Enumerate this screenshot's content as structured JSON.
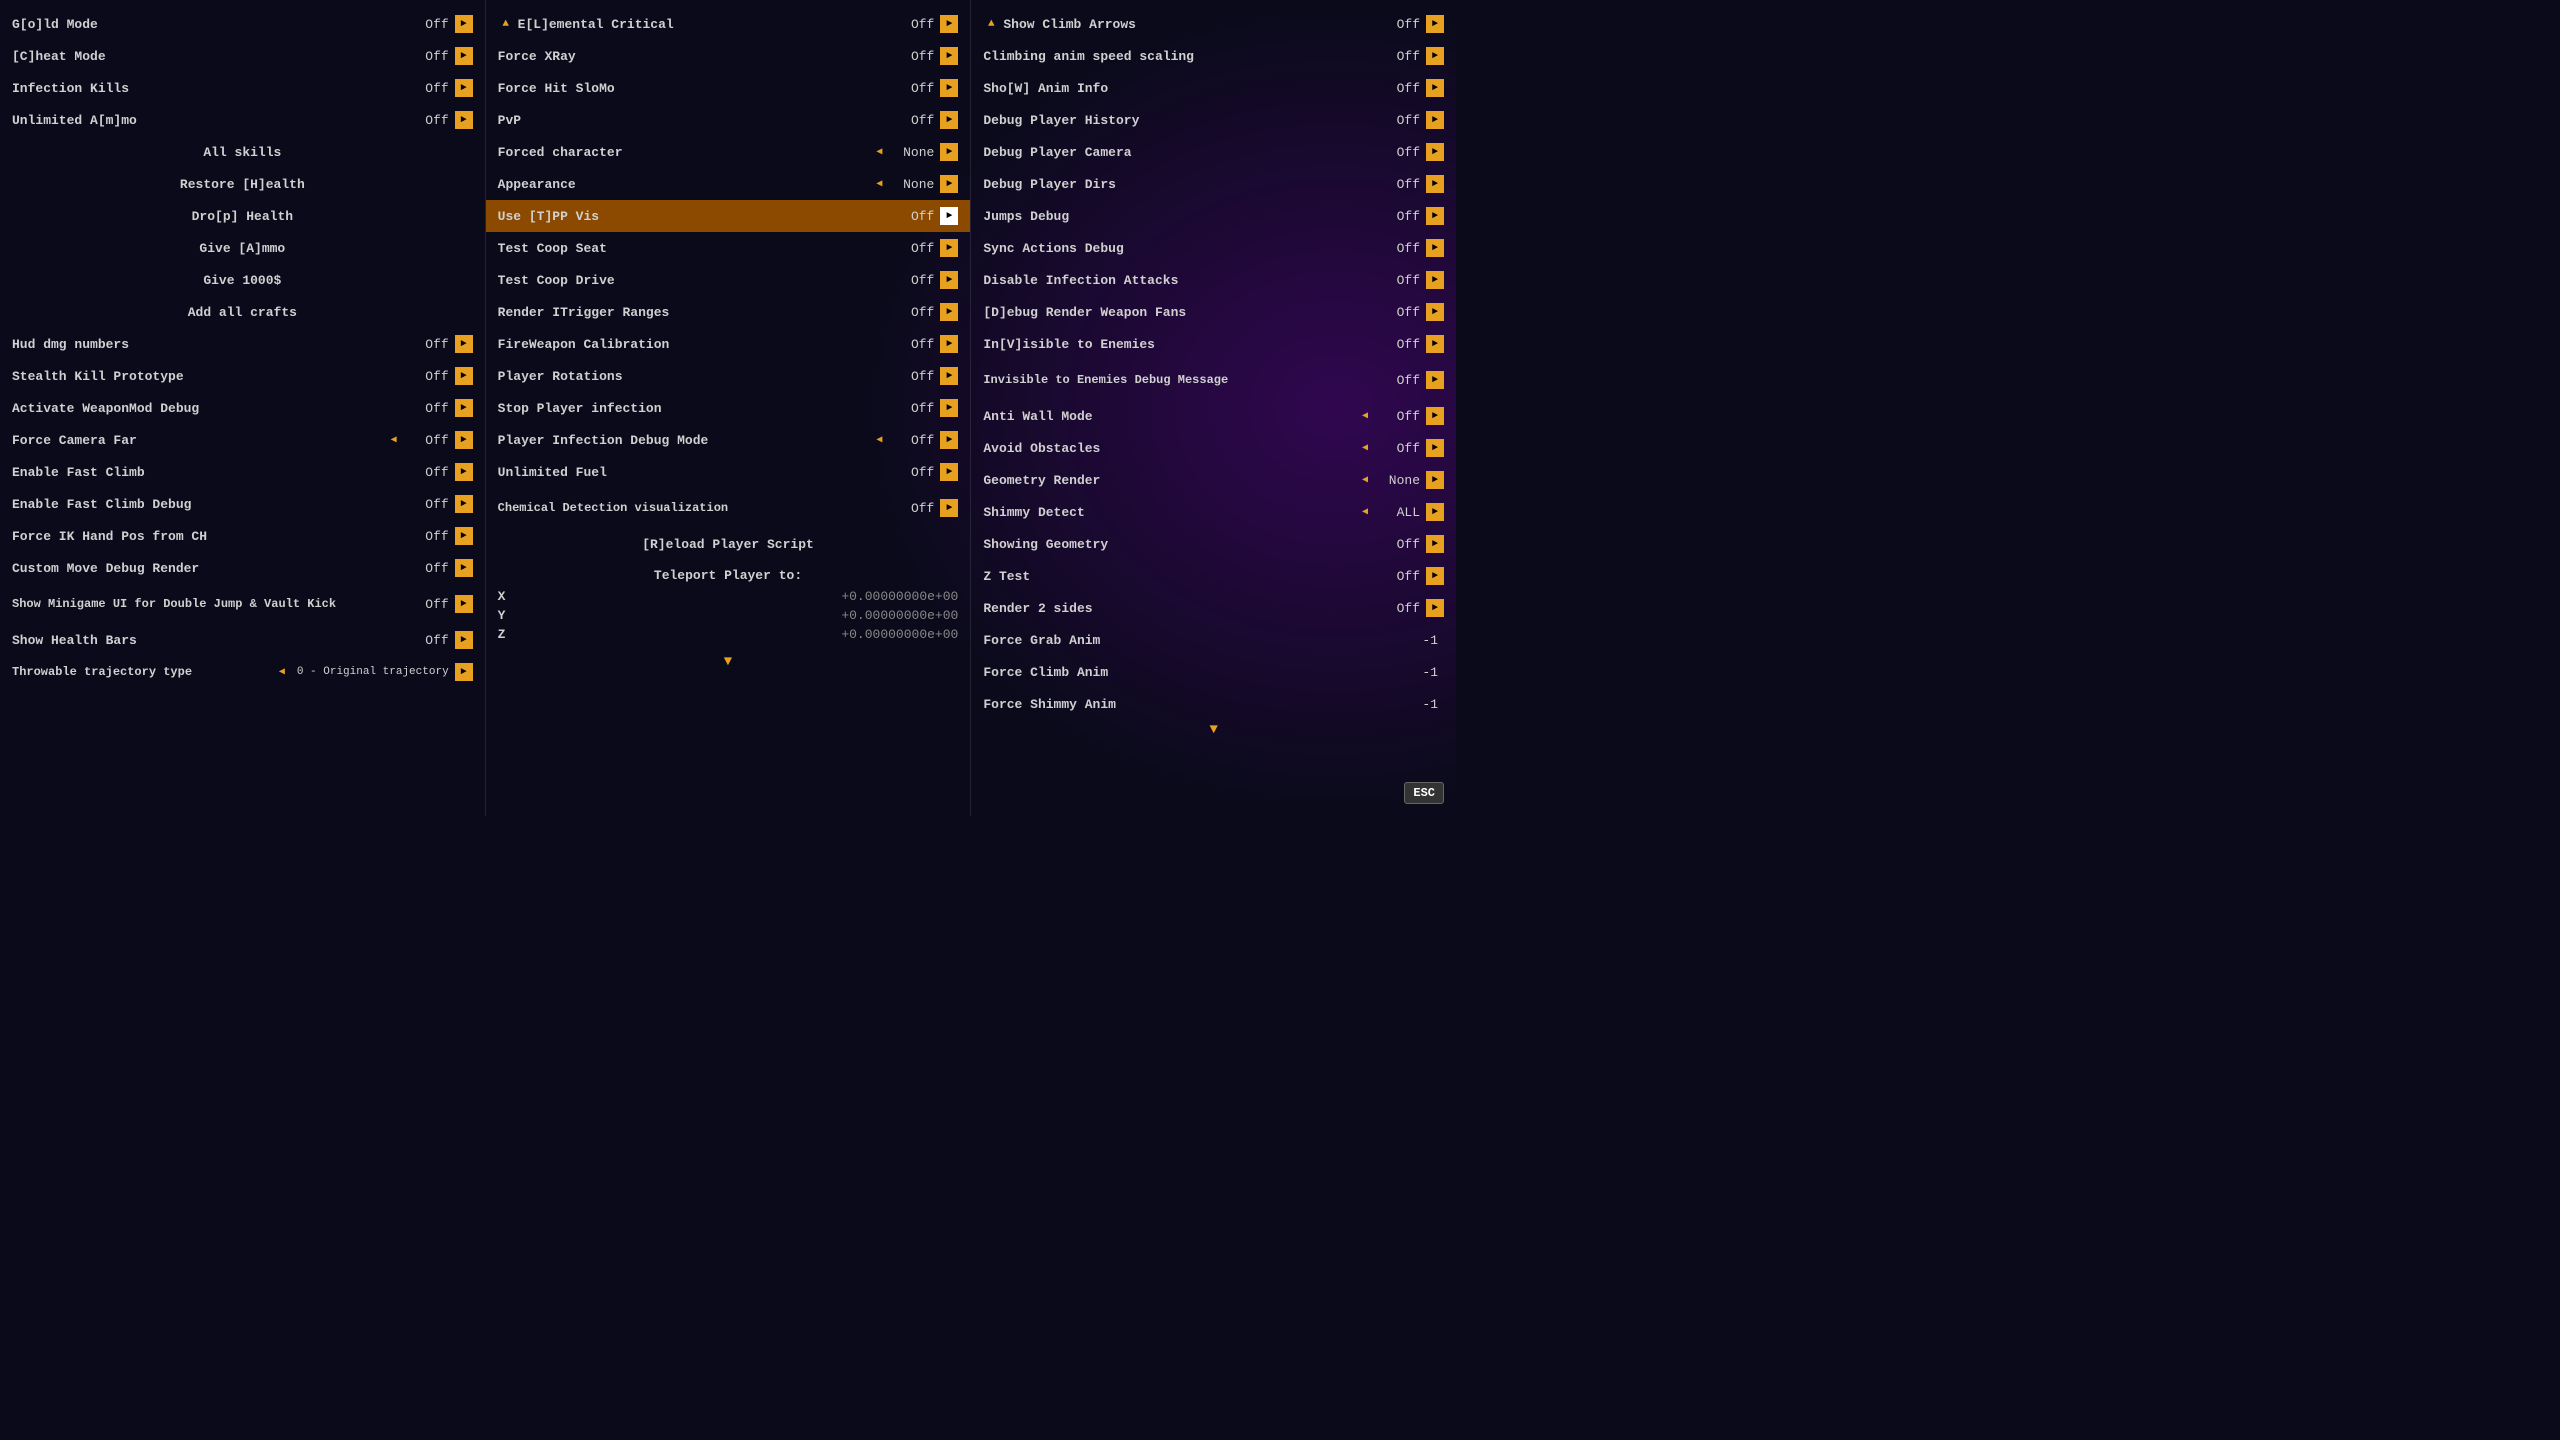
{
  "columns": [
    {
      "id": "col1",
      "items": [
        {
          "id": "gold-mode",
          "label": "G[o]ld Mode",
          "value": "Off",
          "hasLeft": false,
          "hasRight": true,
          "type": "toggle"
        },
        {
          "id": "cheat-mode",
          "label": "[C]heat Mode",
          "value": "Off",
          "hasLeft": false,
          "hasRight": true,
          "type": "toggle"
        },
        {
          "id": "infection-kills",
          "label": "Infection Kills",
          "value": "Off",
          "hasLeft": false,
          "hasRight": true,
          "type": "toggle"
        },
        {
          "id": "unlimited-ammo",
          "label": "Unlimited A[m]mo",
          "value": "Off",
          "hasLeft": false,
          "hasRight": true,
          "type": "toggle"
        },
        {
          "id": "all-skills",
          "label": "All skills",
          "value": "",
          "hasLeft": false,
          "hasRight": false,
          "type": "center"
        },
        {
          "id": "restore-health",
          "label": "Restore [H]ealth",
          "value": "",
          "hasLeft": false,
          "hasRight": false,
          "type": "center"
        },
        {
          "id": "drop-health",
          "label": "Dro[p] Health",
          "value": "",
          "hasLeft": false,
          "hasRight": false,
          "type": "center"
        },
        {
          "id": "give-ammo",
          "label": "Give [A]mmo",
          "value": "",
          "hasLeft": false,
          "hasRight": false,
          "type": "center"
        },
        {
          "id": "give-1000",
          "label": "Give 1000$",
          "value": "",
          "hasLeft": false,
          "hasRight": false,
          "type": "center"
        },
        {
          "id": "add-crafts",
          "label": "Add all crafts",
          "value": "",
          "hasLeft": false,
          "hasRight": false,
          "type": "center"
        },
        {
          "id": "hud-dmg",
          "label": "Hud dmg numbers",
          "value": "Off",
          "hasLeft": false,
          "hasRight": true,
          "type": "toggle"
        },
        {
          "id": "stealth-kill",
          "label": "Stealth Kill Prototype",
          "value": "Off",
          "hasLeft": false,
          "hasRight": true,
          "type": "toggle"
        },
        {
          "id": "weaponmod-debug",
          "label": "Activate WeaponMod Debug",
          "value": "Off",
          "hasLeft": false,
          "hasRight": true,
          "type": "toggle"
        },
        {
          "id": "force-camera-far",
          "label": "Force Camera Far",
          "value": "Off",
          "hasLeft": true,
          "hasRight": true,
          "type": "toggle"
        },
        {
          "id": "enable-fast-climb",
          "label": "Enable Fast Climb",
          "value": "Off",
          "hasLeft": false,
          "hasRight": true,
          "type": "toggle"
        },
        {
          "id": "fast-climb-debug",
          "label": "Enable Fast Climb Debug",
          "value": "Off",
          "hasLeft": false,
          "hasRight": true,
          "type": "toggle"
        },
        {
          "id": "force-ik-hand",
          "label": "Force IK Hand Pos from CH",
          "value": "Off",
          "hasLeft": false,
          "hasRight": true,
          "type": "toggle"
        },
        {
          "id": "custom-move-debug",
          "label": "Custom Move Debug Render",
          "value": "Off",
          "hasLeft": false,
          "hasRight": true,
          "type": "toggle"
        },
        {
          "id": "show-minigame",
          "label": "Show Minigame UI for Double Jump & Vault Kick",
          "value": "Off",
          "hasLeft": false,
          "hasRight": true,
          "type": "toggle"
        },
        {
          "id": "show-health-bars",
          "label": "Show Health Bars",
          "value": "Off",
          "hasLeft": false,
          "hasRight": true,
          "type": "toggle"
        },
        {
          "id": "throwable-traj",
          "label": "Throwable trajectory type",
          "value": "0 - Original trajectory",
          "hasLeft": true,
          "hasRight": true,
          "type": "toggle"
        }
      ]
    },
    {
      "id": "col2",
      "sectionArrow": "up",
      "sectionLabel": "E[L]emental Critical",
      "sectionValue": "Off",
      "items": [
        {
          "id": "force-xray",
          "label": "Force XRay",
          "value": "Off",
          "hasLeft": false,
          "hasRight": true,
          "type": "toggle"
        },
        {
          "id": "force-hit-slomo",
          "label": "Force Hit SloMo",
          "value": "Off",
          "hasLeft": false,
          "hasRight": true,
          "type": "toggle"
        },
        {
          "id": "pvp",
          "label": "PvP",
          "value": "Off",
          "hasLeft": false,
          "hasRight": true,
          "type": "toggle"
        },
        {
          "id": "forced-character",
          "label": "Forced character",
          "value": "None",
          "hasLeft": true,
          "hasRight": true,
          "type": "select"
        },
        {
          "id": "appearance",
          "label": "Appearance",
          "value": "None",
          "hasLeft": true,
          "hasRight": true,
          "type": "select"
        },
        {
          "id": "use-tpp-vis",
          "label": "Use [T]PP Vis",
          "value": "Off",
          "hasLeft": false,
          "hasRight": true,
          "type": "toggle",
          "highlighted": true
        },
        {
          "id": "test-coop-seat",
          "label": "Test Coop Seat",
          "value": "Off",
          "hasLeft": false,
          "hasRight": true,
          "type": "toggle"
        },
        {
          "id": "test-coop-drive",
          "label": "Test Coop Drive",
          "value": "Off",
          "hasLeft": false,
          "hasRight": true,
          "type": "toggle"
        },
        {
          "id": "render-itrigger",
          "label": "Render ITrigger Ranges",
          "value": "Off",
          "hasLeft": false,
          "hasRight": true,
          "type": "toggle"
        },
        {
          "id": "fireweapon-cal",
          "label": "FireWeapon Calibration",
          "value": "Off",
          "hasLeft": false,
          "hasRight": true,
          "type": "toggle"
        },
        {
          "id": "player-rotations",
          "label": "Player Rotations",
          "value": "Off",
          "hasLeft": false,
          "hasRight": true,
          "type": "toggle"
        },
        {
          "id": "stop-infection",
          "label": "Stop Player infection",
          "value": "Off",
          "hasLeft": false,
          "hasRight": true,
          "type": "toggle"
        },
        {
          "id": "infection-debug",
          "label": "Player Infection Debug Mode",
          "value": "Off",
          "hasLeft": true,
          "hasRight": true,
          "type": "select"
        },
        {
          "id": "unlimited-fuel",
          "label": "Unlimited Fuel",
          "value": "Off",
          "hasLeft": false,
          "hasRight": true,
          "type": "toggle"
        },
        {
          "id": "chemical-detection",
          "label": "Chemical Detection visualization",
          "value": "Off",
          "hasLeft": false,
          "hasRight": true,
          "type": "toggle"
        },
        {
          "id": "reload-script",
          "label": "[R]eload Player Script",
          "value": "",
          "hasLeft": false,
          "hasRight": false,
          "type": "center"
        }
      ],
      "teleport": {
        "title": "Teleport Player to:",
        "axes": [
          {
            "axis": "X",
            "value": "+0.00000000e+00"
          },
          {
            "axis": "Y",
            "value": "+0.00000000e+00"
          },
          {
            "axis": "Z",
            "value": "+0.00000000e+00"
          }
        ]
      }
    },
    {
      "id": "col3",
      "sectionArrow": "up",
      "sectionLabel": "Show Climb Arrows",
      "sectionValue": "Off",
      "items": [
        {
          "id": "climb-anim-speed",
          "label": "Climbing anim speed scaling",
          "value": "Off",
          "hasLeft": false,
          "hasRight": true,
          "type": "toggle"
        },
        {
          "id": "show-anim-info",
          "label": "Sho[W] Anim Info",
          "value": "Off",
          "hasLeft": false,
          "hasRight": true,
          "type": "toggle"
        },
        {
          "id": "debug-player-history",
          "label": "Debug Player History",
          "value": "Off",
          "hasLeft": false,
          "hasRight": true,
          "type": "toggle"
        },
        {
          "id": "debug-player-camera",
          "label": "Debug Player Camera",
          "value": "Off",
          "hasLeft": false,
          "hasRight": true,
          "type": "toggle"
        },
        {
          "id": "debug-player-dirs",
          "label": "Debug Player Dirs",
          "value": "Off",
          "hasLeft": false,
          "hasRight": true,
          "type": "toggle"
        },
        {
          "id": "jumps-debug",
          "label": "Jumps Debug",
          "value": "Off",
          "hasLeft": false,
          "hasRight": true,
          "type": "toggle"
        },
        {
          "id": "sync-actions-debug",
          "label": "Sync Actions Debug",
          "value": "Off",
          "hasLeft": false,
          "hasRight": true,
          "type": "toggle"
        },
        {
          "id": "disable-infection",
          "label": "Disable Infection Attacks",
          "value": "Off",
          "hasLeft": false,
          "hasRight": true,
          "type": "toggle"
        },
        {
          "id": "debug-render-weapon",
          "label": "[D]ebug Render Weapon Fans",
          "value": "Off",
          "hasLeft": false,
          "hasRight": true,
          "type": "toggle"
        },
        {
          "id": "invisible-enemies",
          "label": "In[V]isible to Enemies",
          "value": "Off",
          "hasLeft": false,
          "hasRight": true,
          "type": "toggle"
        },
        {
          "id": "invisible-debug-msg",
          "label": "Invisible to Enemies Debug Message",
          "value": "Off",
          "hasLeft": false,
          "hasRight": true,
          "type": "toggle"
        },
        {
          "id": "anti-wall-mode",
          "label": "Anti Wall Mode",
          "value": "Off",
          "hasLeft": true,
          "hasRight": true,
          "type": "select"
        },
        {
          "id": "avoid-obstacles",
          "label": "Avoid Obstacles",
          "value": "Off",
          "hasLeft": true,
          "hasRight": true,
          "type": "select"
        },
        {
          "id": "geometry-render",
          "label": "Geometry Render",
          "value": "None",
          "hasLeft": true,
          "hasRight": true,
          "type": "select"
        },
        {
          "id": "shimmy-detect",
          "label": "Shimmy Detect",
          "value": "ALL",
          "hasLeft": true,
          "hasRight": true,
          "type": "select"
        },
        {
          "id": "showing-geometry",
          "label": "Showing Geometry",
          "value": "Off",
          "hasLeft": false,
          "hasRight": true,
          "type": "toggle"
        },
        {
          "id": "z-test",
          "label": "Z Test",
          "value": "Off",
          "hasLeft": false,
          "hasRight": true,
          "type": "toggle"
        },
        {
          "id": "render-2sides",
          "label": "Render 2 sides",
          "value": "Off",
          "hasLeft": false,
          "hasRight": true,
          "type": "toggle"
        },
        {
          "id": "force-grab-anim",
          "label": "Force Grab Anim",
          "value": "-1",
          "hasLeft": false,
          "hasRight": false,
          "type": "value"
        },
        {
          "id": "force-climb-anim",
          "label": "Force Climb Anim",
          "value": "-1",
          "hasLeft": false,
          "hasRight": false,
          "type": "value"
        },
        {
          "id": "force-shimmy-anim",
          "label": "Force Shimmy Anim",
          "value": "-1",
          "hasLeft": false,
          "hasRight": false,
          "type": "value"
        }
      ]
    }
  ],
  "esc_label": "ESC"
}
